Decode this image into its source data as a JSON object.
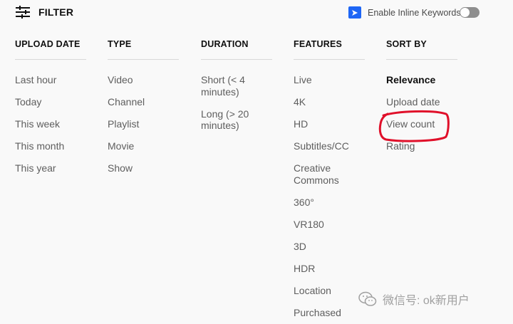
{
  "topbar": {
    "filter_label": "FILTER",
    "inline_keywords_label": "Enable Inline Keywords",
    "inline_keywords_on": false
  },
  "columns": [
    {
      "header": "UPLOAD DATE",
      "items": [
        "Last hour",
        "Today",
        "This week",
        "This month",
        "This year"
      ]
    },
    {
      "header": "TYPE",
      "items": [
        "Video",
        "Channel",
        "Playlist",
        "Movie",
        "Show"
      ]
    },
    {
      "header": "DURATION",
      "items": [
        "Short (< 4 minutes)",
        "Long (> 20 minutes)"
      ]
    },
    {
      "header": "FEATURES",
      "items": [
        "Live",
        "4K",
        "HD",
        "Subtitles/CC",
        "Creative Commons",
        "360°",
        "VR180",
        "3D",
        "HDR",
        "Location",
        "Purchased"
      ]
    },
    {
      "header": "SORT BY",
      "items": [
        "Relevance",
        "Upload date",
        "View count",
        "Rating"
      ],
      "selected": "Relevance"
    }
  ],
  "annotation": {
    "highlighted_item": "View count",
    "color": "#e0102a"
  },
  "watermark": {
    "text": "微信号: ok新用户"
  },
  "colors": {
    "background": "#f9f9f9",
    "text_primary": "#0f0f0f",
    "text_secondary": "#5e5e5e",
    "extension_icon": "#1e66f5"
  }
}
